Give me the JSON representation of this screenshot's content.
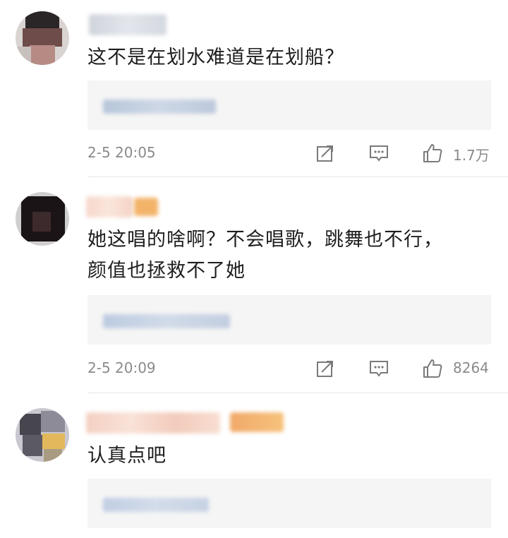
{
  "comments": [
    {
      "text": "这不是在划水难道是在划船？",
      "time": "2-5 20:05",
      "likes": "1.7万"
    },
    {
      "text": "她这唱的啥啊？不会唱歌，跳舞也不行，颜值也拯救不了她",
      "time": "2-5 20:09",
      "likes": "8264"
    },
    {
      "text": "认真点吧",
      "time": "",
      "likes": ""
    }
  ],
  "icons": {
    "share": "share-icon",
    "comment": "comment-icon",
    "like": "thumbs-up-icon"
  },
  "colors": {
    "meta_text": "#8a8a8a",
    "quote_bg": "#f5f5f5",
    "icon": "#7a7a7a"
  }
}
